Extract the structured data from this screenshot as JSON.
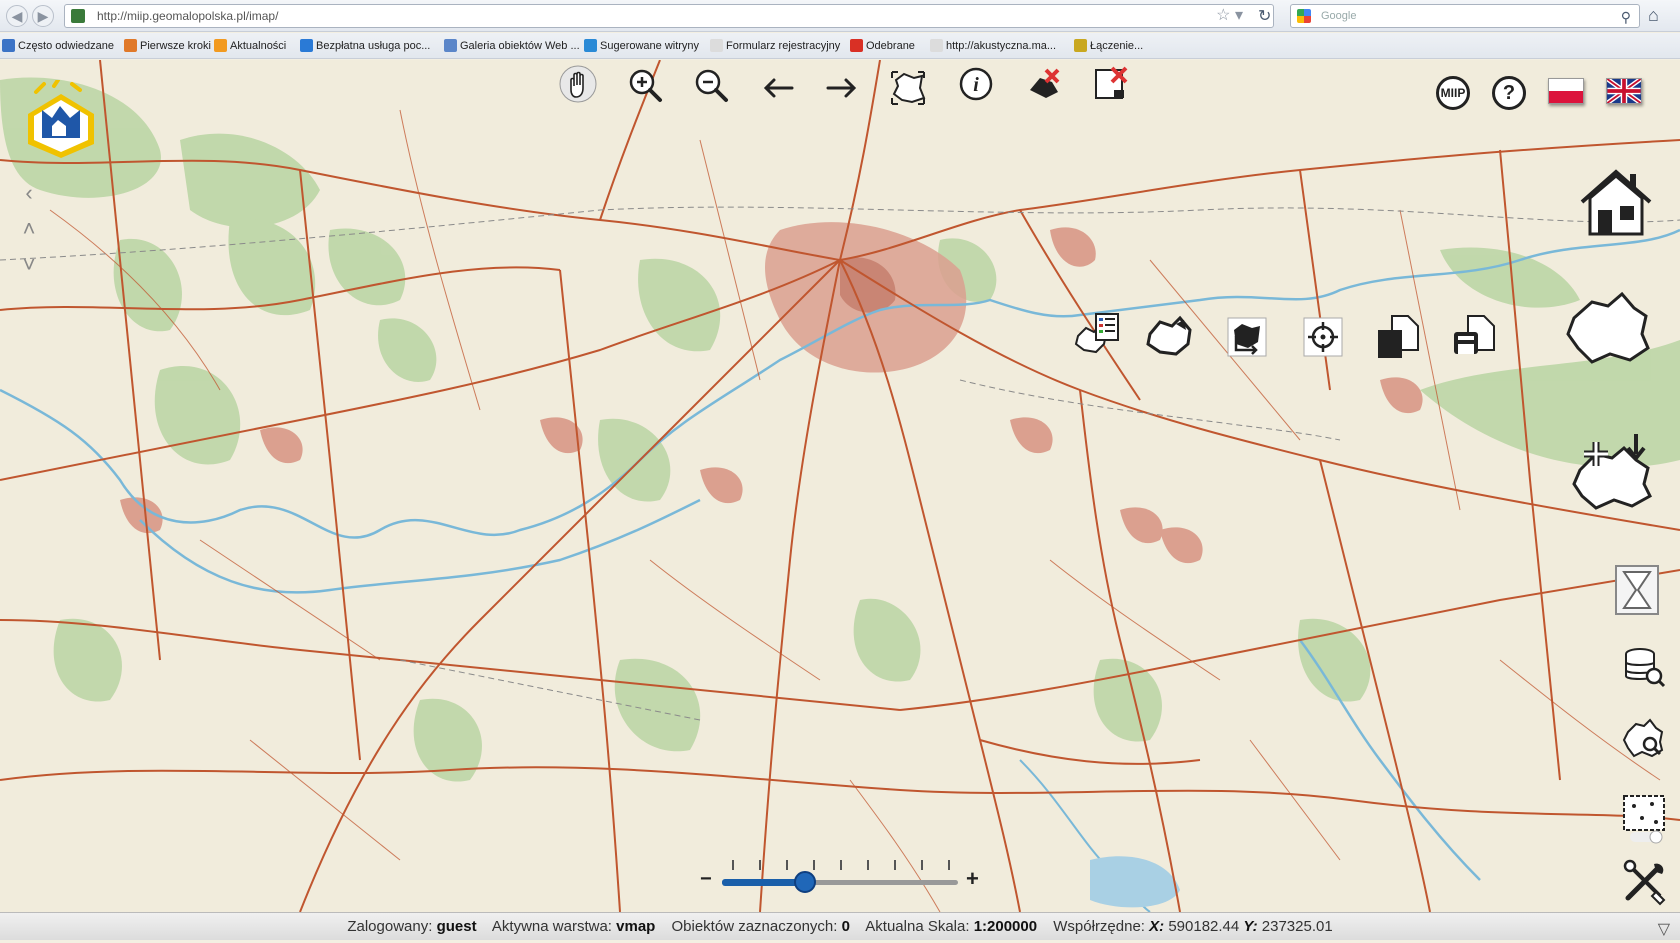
{
  "browser": {
    "url": "http://miip.geomalopolska.pl/imap/",
    "search_placeholder": "Google",
    "bookmarks": [
      {
        "label": "Często odwiedzane",
        "color": "#3b73c6"
      },
      {
        "label": "Pierwsze kroki",
        "color": "#e0792a"
      },
      {
        "label": "Aktualności",
        "color": "#f29a20"
      },
      {
        "label": "Bezpłatna usługa poc...",
        "color": "#2a7ad6"
      },
      {
        "label": "Galeria obiektów Web ...",
        "color": "#5b86c9"
      },
      {
        "label": "Sugerowane witryny",
        "color": "#2a8ad6"
      },
      {
        "label": "Formularz rejestracyjny",
        "color": "#dcdcdc"
      },
      {
        "label": "Odebrane",
        "color": "#d93025"
      },
      {
        "label": "http://akustyczna.ma...",
        "color": "#dcdcdc"
      },
      {
        "label": "Łączenie...",
        "color": "#c9a820"
      }
    ]
  },
  "toolbar": {
    "tools": [
      "pan-icon",
      "zoom-in-icon",
      "zoom-out-icon",
      "back-icon",
      "forward-icon",
      "full-extent-icon",
      "info-icon",
      "clear-selection-icon",
      "clear-layer-icon"
    ],
    "miip_label": "MIIP",
    "help_label": "?"
  },
  "zoom": {
    "minus": "−",
    "plus": "+",
    "level": 0.35
  },
  "status": {
    "user_label": "Zalogowany:",
    "user_value": "guest",
    "layer_label": "Aktywna warstwa:",
    "layer_value": "vmap",
    "selected_label": "Obiektów zaznaczonych:",
    "selected_value": "0",
    "scale_label": "Aktualna Skala:",
    "scale_value": "1:200000",
    "coords_label": "Współrzędne:",
    "x_label": "X:",
    "x_value": "590182.44",
    "y_label": "Y:",
    "y_value": "237325.01"
  },
  "colors": {
    "road": "#c0562f",
    "river": "#79b8d8",
    "forest": "#b6d3a0",
    "urban": "#e0a494",
    "map_bg": "#f1ecdc"
  }
}
